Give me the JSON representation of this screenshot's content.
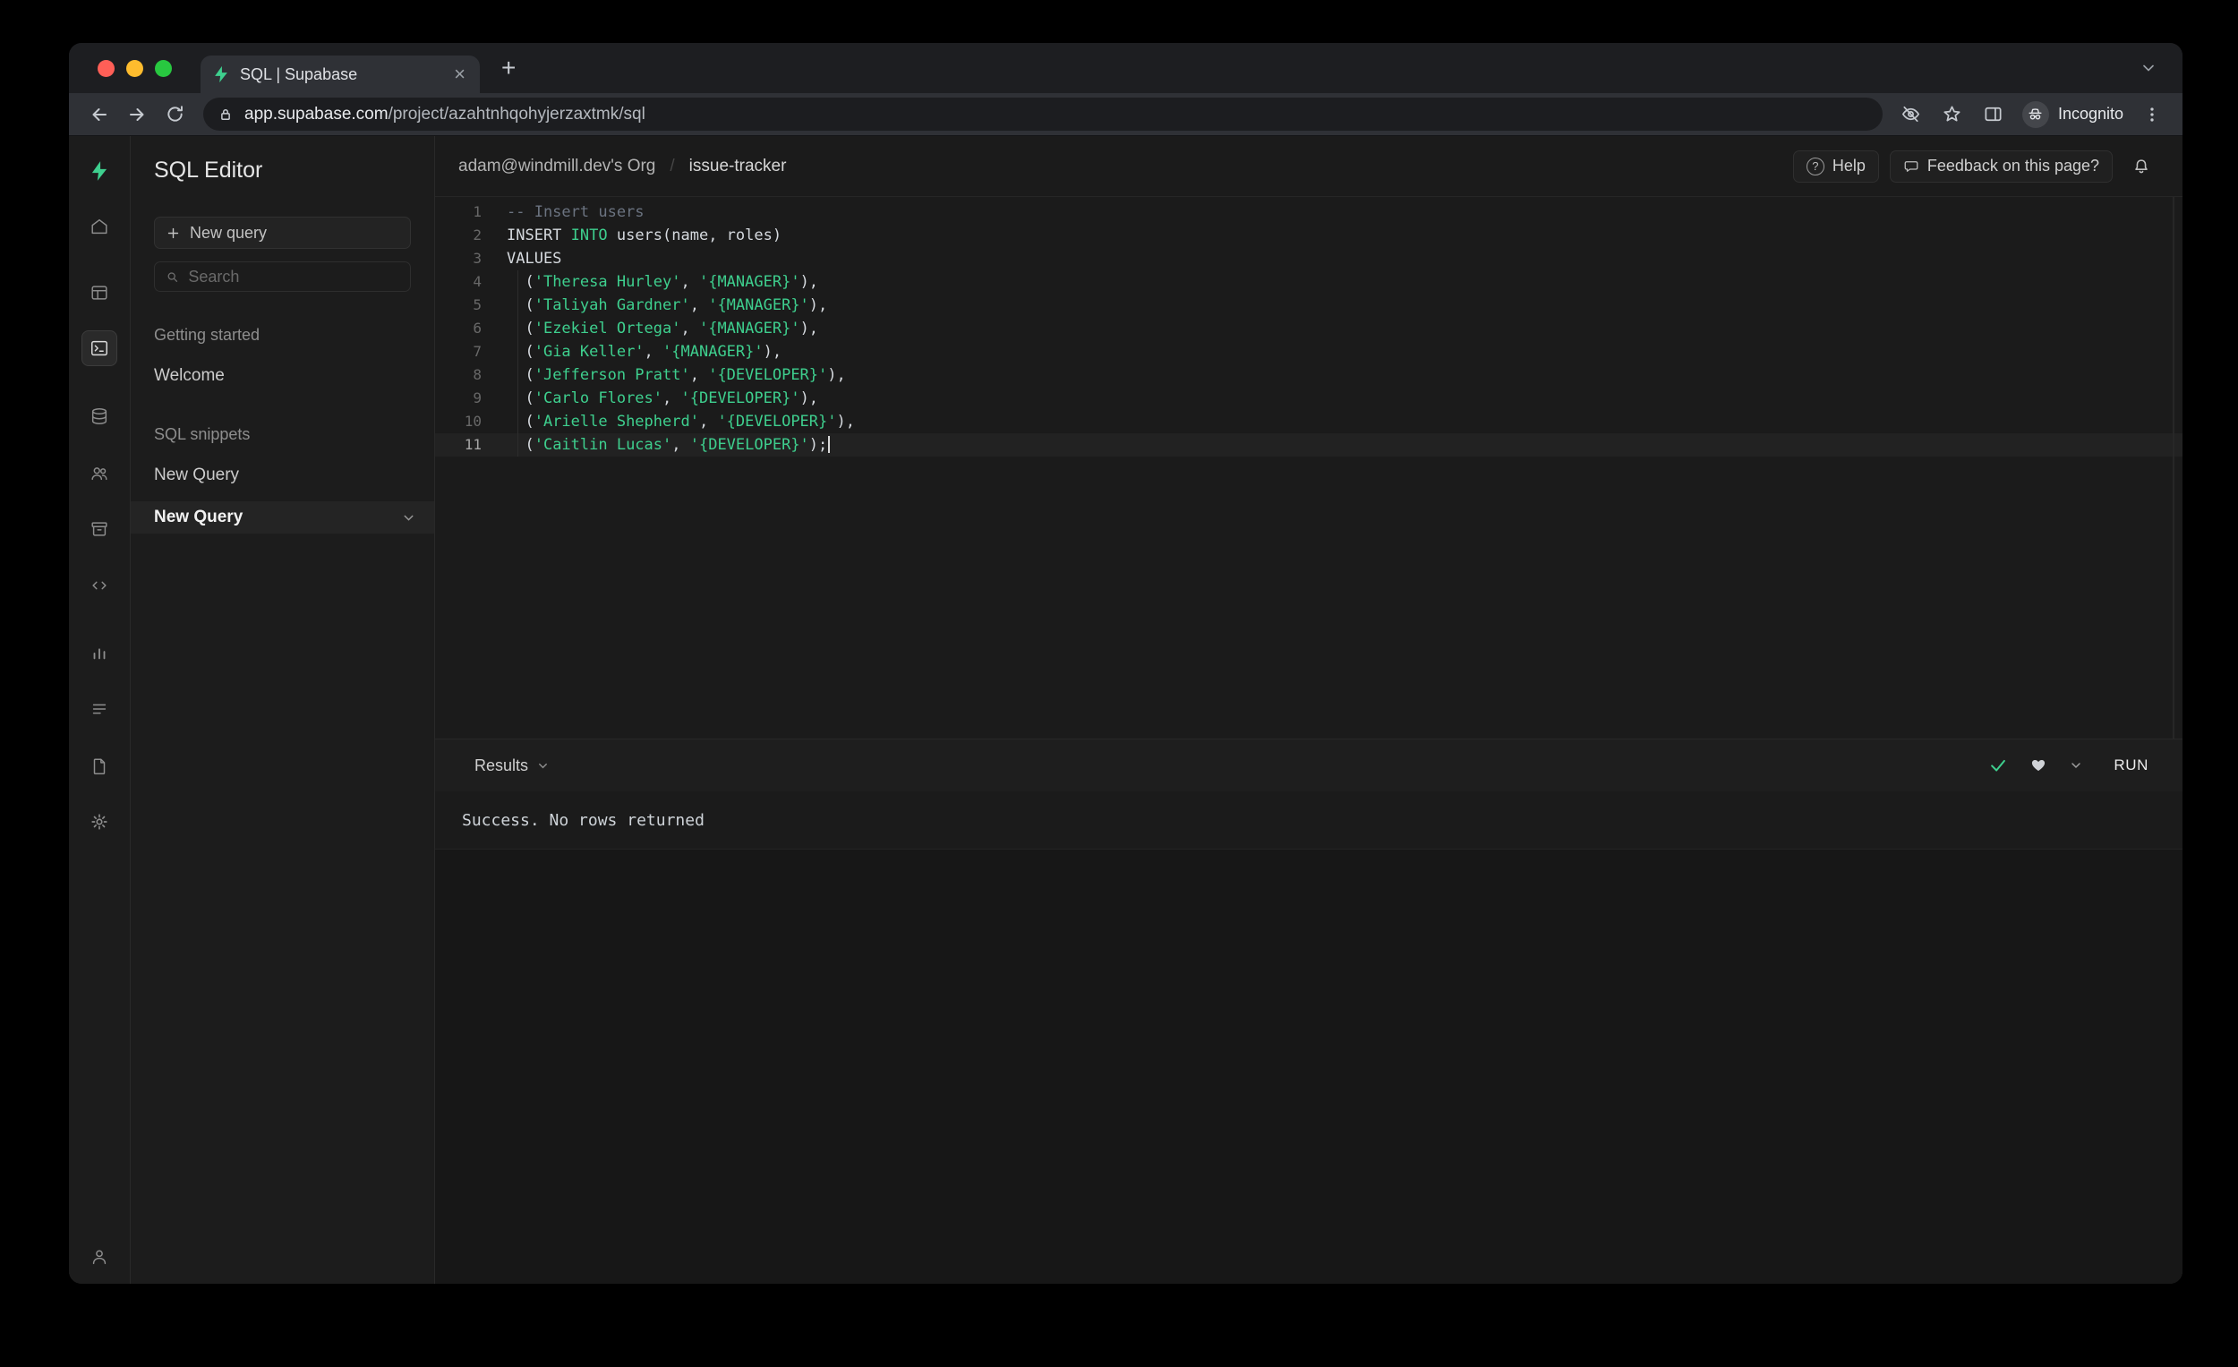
{
  "browser": {
    "tab_title": "SQL | Supabase",
    "url_domain": "app.supabase.com",
    "url_path": "/project/azahtnhqohyjerzaxtmk/sql",
    "incognito_label": "Incognito"
  },
  "rail_icons": [
    "supabase-logo",
    "home",
    "table-editor",
    "sql-editor",
    "database",
    "auth",
    "storage",
    "edge-functions",
    "reports",
    "logs",
    "docs",
    "settings",
    "account"
  ],
  "toolbar_icons": [
    "back",
    "forward",
    "reload",
    "lock",
    "eye-off",
    "star",
    "side-panel",
    "incognito-spy",
    "kebab-menu"
  ],
  "sidebar": {
    "title": "SQL Editor",
    "new_query_label": "New query",
    "search_placeholder": "Search",
    "section_getting_started": "Getting started",
    "item_welcome": "Welcome",
    "section_snippets": "SQL snippets",
    "item_new_query": "New Query",
    "selected_query": "New Query"
  },
  "header": {
    "org": "adam@windmill.dev's Org",
    "separator": "/",
    "project": "issue-tracker",
    "help_label": "Help",
    "help_icon_glyph": "?",
    "feedback_label": "Feedback on this page?"
  },
  "editor": {
    "lines": [
      "-- Insert users",
      "INSERT INTO users(name, roles)",
      "VALUES",
      "  ('Theresa Hurley', '{MANAGER}'),",
      "  ('Taliyah Gardner', '{MANAGER}'),",
      "  ('Ezekiel Ortega', '{MANAGER}'),",
      "  ('Gia Keller', '{MANAGER}'),",
      "  ('Jefferson Pratt', '{DEVELOPER}'),",
      "  ('Carlo Flores', '{DEVELOPER}'),",
      "  ('Arielle Shepherd', '{DEVELOPER}'),",
      "  ('Caitlin Lucas', '{DEVELOPER}');"
    ]
  },
  "results": {
    "label": "Results",
    "run_label": "RUN",
    "message": "Success. No rows returned"
  },
  "colors": {
    "accent_green": "#3ecf8e",
    "string_green": "#3ecf8e",
    "comment_gray": "#6b7380"
  }
}
